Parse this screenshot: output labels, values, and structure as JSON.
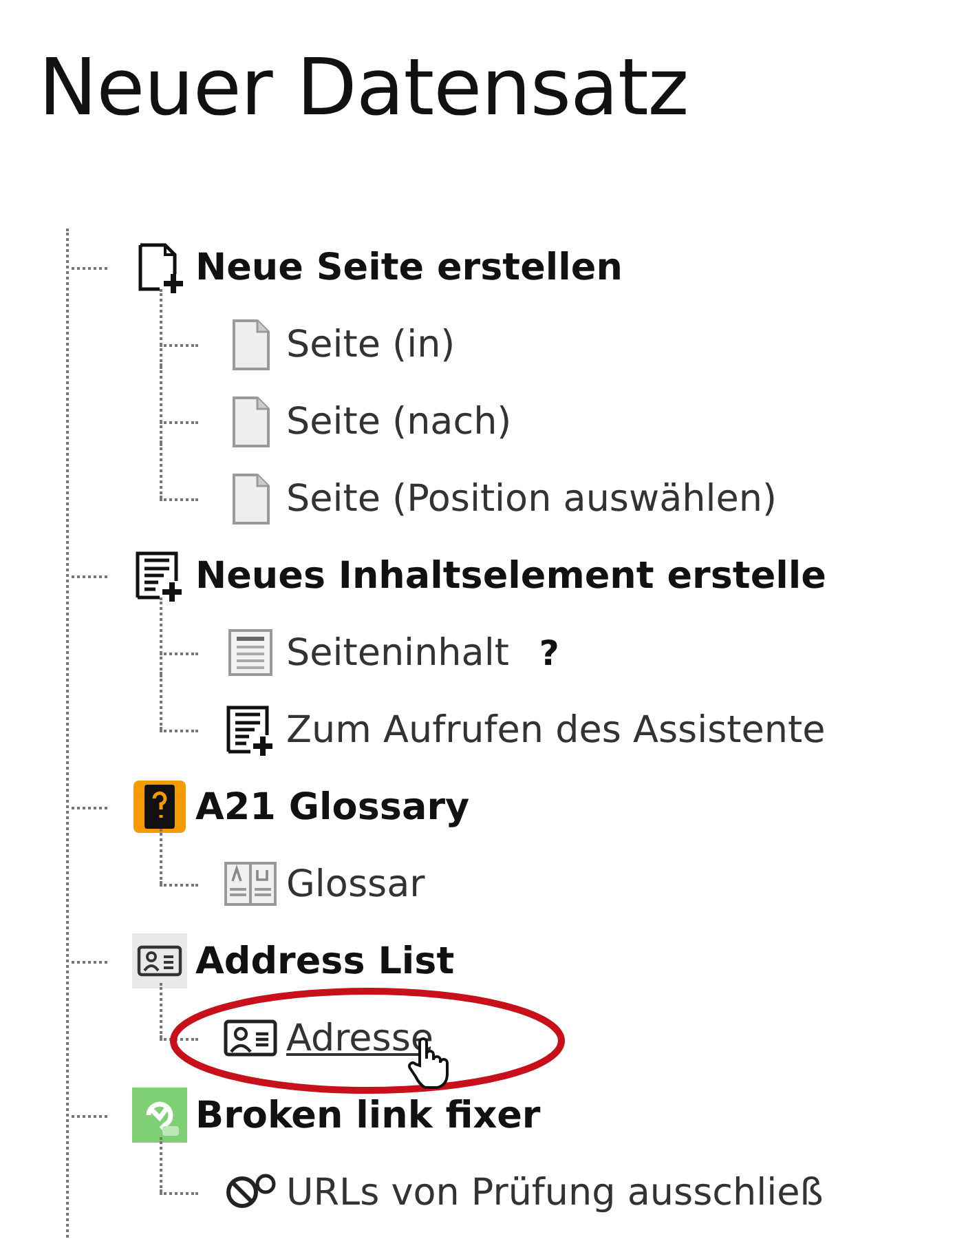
{
  "title": "Neuer Datensatz",
  "groups": [
    {
      "label": "Neue Seite erstellen",
      "kind": "page-plus",
      "children": [
        {
          "label": "Seite (in)",
          "kind": "page",
          "highlighted": false
        },
        {
          "label": "Seite (nach)",
          "kind": "page",
          "highlighted": false
        },
        {
          "label": "Seite (Position auswählen)",
          "kind": "page",
          "highlighted": false
        }
      ]
    },
    {
      "label": "Neues Inhaltselement erstelle",
      "kind": "content-plus",
      "children": [
        {
          "label": "Seiteninhalt",
          "kind": "content",
          "help": "?",
          "highlighted": false
        },
        {
          "label": "Zum Aufrufen des Assistente",
          "kind": "content-plus",
          "highlighted": false
        }
      ]
    },
    {
      "label": "A21 Glossary",
      "kind": "glossary",
      "children": [
        {
          "label": "Glossar",
          "kind": "book",
          "highlighted": false
        }
      ]
    },
    {
      "label": "Address List",
      "kind": "address-card",
      "children": [
        {
          "label": "Adresse",
          "kind": "address",
          "highlighted": true
        }
      ]
    },
    {
      "label": "Broken link fixer",
      "kind": "link-fixer",
      "children": [
        {
          "label": "URLs von Prüfung ausschließ",
          "kind": "no-link",
          "highlighted": false
        }
      ]
    }
  ]
}
